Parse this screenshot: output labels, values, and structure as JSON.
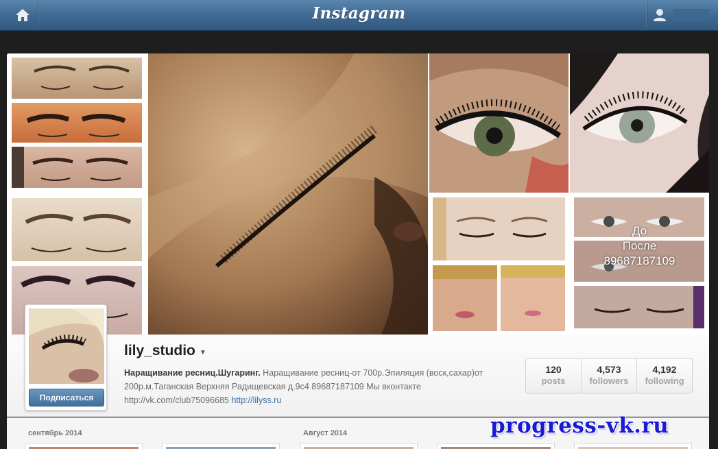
{
  "header": {
    "brand": "Instagram",
    "home_icon": "home-icon",
    "user_icon": "user-silhouette-icon"
  },
  "mosaic": {
    "before_after_overlay": [
      "До",
      "После",
      "89687187109"
    ]
  },
  "profile": {
    "username": "lily_studio",
    "follow_label": "Подписаться",
    "bio_bold": "Наращивание ресниц.Шугаринг.",
    "bio_text": "Наращивание ресниц-от 700р.Эпиляция (воск,сахар)от 200р.м.Таганская Верхняя Радищевская д.9с4 89687187109    Мы вконтакте http://vk.com/club75096685",
    "bio_link": "http://lilyss.ru",
    "stats": [
      {
        "value": "120",
        "label": "posts"
      },
      {
        "value": "4,573",
        "label": "followers"
      },
      {
        "value": "4,192",
        "label": "following"
      }
    ]
  },
  "feed": {
    "months": [
      "сентябрь 2014",
      "Август 2014"
    ]
  },
  "watermark": "progress-vk.ru",
  "colors": {
    "topbar": "#3e6791",
    "follow_button": "#4f7fad",
    "link": "#3b6fa3",
    "watermark": "#1a1ad6"
  }
}
